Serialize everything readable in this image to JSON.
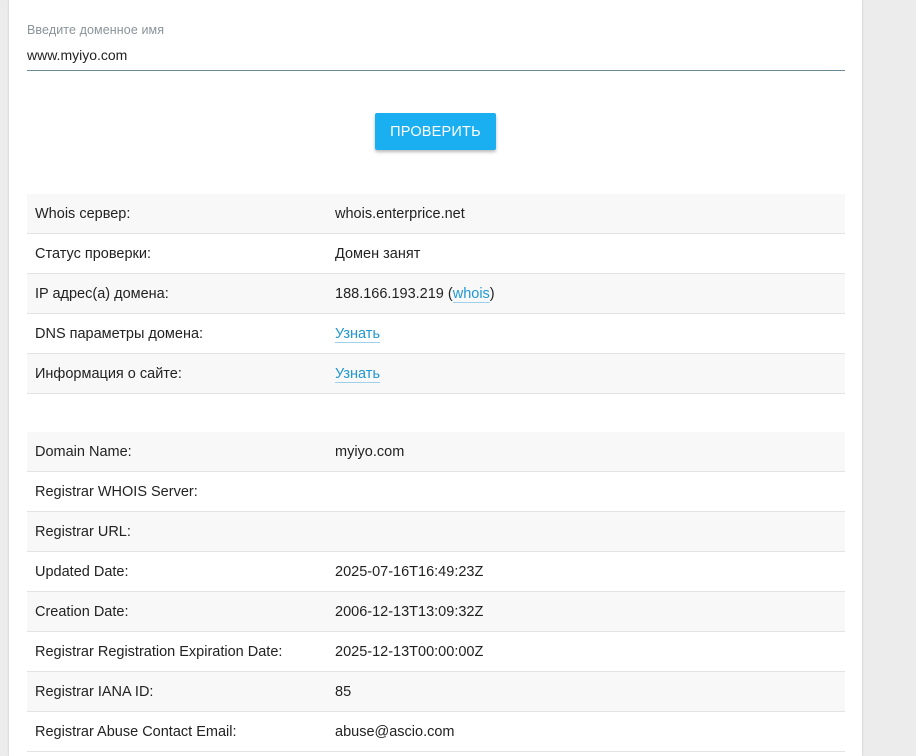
{
  "form": {
    "label": "Введите доменное имя",
    "value": "www.myiyo.com",
    "button_label": "ПРОВЕРИТЬ"
  },
  "check_table": {
    "rows": [
      {
        "key": "Whois сервер:",
        "value": "whois.enterprice.net"
      },
      {
        "key": "Статус проверки:",
        "value": "Домен занят"
      },
      {
        "key": "IP адрес(а) домена:",
        "value": "188.166.193.219",
        "link": "whois",
        "open": " (",
        "close": ")"
      },
      {
        "key": "DNS параметры домена:",
        "link": "Узнать"
      },
      {
        "key": "Информация о сайте:",
        "link": "Узнать"
      }
    ]
  },
  "whois_table": {
    "rows": [
      {
        "key": "Domain Name:",
        "value": "myiyo.com"
      },
      {
        "key": "Registrar WHOIS Server:",
        "value": ""
      },
      {
        "key": "Registrar URL:",
        "value": ""
      },
      {
        "key": "Updated Date:",
        "value": "2025-07-16T16:49:23Z"
      },
      {
        "key": "Creation Date:",
        "value": "2006-12-13T13:09:32Z"
      },
      {
        "key": "Registrar Registration Expiration Date:",
        "value": "2025-12-13T00:00:00Z"
      },
      {
        "key": "Registrar IANA ID:",
        "value": "85"
      },
      {
        "key": "Registrar Abuse Contact Email:",
        "value": "abuse@ascio.com"
      }
    ]
  },
  "colors": {
    "accent": "#1aaff0",
    "link": "#1f97d4",
    "background": "#ececec"
  }
}
